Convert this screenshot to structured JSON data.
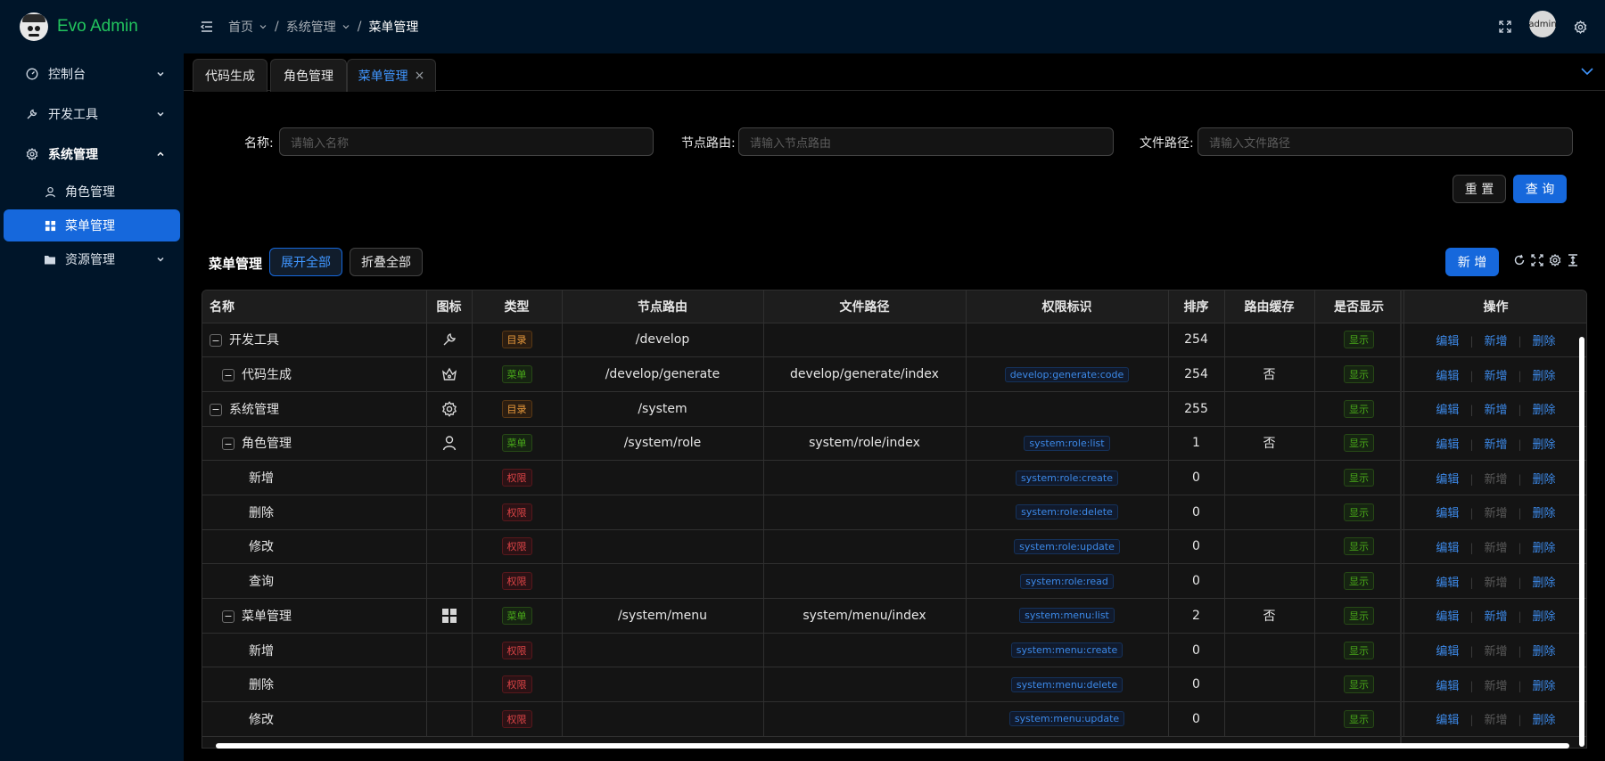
{
  "app": {
    "title": "Evo Admin"
  },
  "sidebar": {
    "items": [
      {
        "label": "控制台",
        "icon": "dashboard-icon"
      },
      {
        "label": "开发工具",
        "icon": "tool-icon"
      },
      {
        "label": "系统管理",
        "icon": "gear-icon",
        "children": [
          {
            "label": "角色管理",
            "icon": "user-icon"
          },
          {
            "label": "菜单管理",
            "icon": "grid-icon",
            "active": true
          }
        ]
      },
      {
        "label": "资源管理",
        "icon": "folder-icon"
      }
    ]
  },
  "header": {
    "breadcrumb": [
      "首页",
      "系统管理",
      "菜单管理"
    ],
    "avatar": "admin"
  },
  "tabs": [
    {
      "label": "代码生成"
    },
    {
      "label": "角色管理"
    },
    {
      "label": "菜单管理",
      "active": true,
      "close": "×"
    }
  ],
  "search": {
    "name_label": "名称:",
    "name_placeholder": "请输入名称",
    "route_label": "节点路由:",
    "route_placeholder": "请输入节点路由",
    "path_label": "文件路径:",
    "path_placeholder": "请输入文件路径",
    "reset": "重 置",
    "query": "查 询"
  },
  "toolbar": {
    "title": "菜单管理",
    "expand_all": "展开全部",
    "collapse_all": "折叠全部",
    "add": "新 增"
  },
  "table": {
    "columns": [
      "名称",
      "图标",
      "类型",
      "节点路由",
      "文件路径",
      "权限标识",
      "排序",
      "路由缓存",
      "是否显示",
      "操作"
    ],
    "ops": {
      "edit": "编辑",
      "add": "新增",
      "delete": "删除"
    },
    "rows": [
      {
        "name": "开发工具",
        "level": 0,
        "expand": "−",
        "icon": "wrench-icon",
        "type": "目录",
        "route": "/develop",
        "path": "",
        "perm": "",
        "sort": "254",
        "cache": "",
        "show": "显示"
      },
      {
        "name": "代码生成",
        "level": 1,
        "expand": "−",
        "icon": "crown-icon",
        "type": "菜单",
        "route": "/develop/generate",
        "path": "develop/generate/index",
        "perm": "develop:generate:code",
        "sort": "254",
        "cache": "否",
        "show": "显示"
      },
      {
        "name": "系统管理",
        "level": 0,
        "expand": "−",
        "icon": "gear-icon",
        "type": "目录",
        "route": "/system",
        "path": "",
        "perm": "",
        "sort": "255",
        "cache": "",
        "show": "显示"
      },
      {
        "name": "角色管理",
        "level": 1,
        "expand": "−",
        "icon": "user-icon",
        "type": "菜单",
        "route": "/system/role",
        "path": "system/role/index",
        "perm": "system:role:list",
        "sort": "1",
        "cache": "否",
        "show": "显示"
      },
      {
        "name": "新增",
        "level": 2,
        "type": "权限",
        "route": "",
        "path": "",
        "perm": "system:role:create",
        "sort": "0",
        "cache": "",
        "show": "显示"
      },
      {
        "name": "删除",
        "level": 2,
        "type": "权限",
        "route": "",
        "path": "",
        "perm": "system:role:delete",
        "sort": "0",
        "cache": "",
        "show": "显示"
      },
      {
        "name": "修改",
        "level": 2,
        "type": "权限",
        "route": "",
        "path": "",
        "perm": "system:role:update",
        "sort": "0",
        "cache": "",
        "show": "显示"
      },
      {
        "name": "查询",
        "level": 2,
        "type": "权限",
        "route": "",
        "path": "",
        "perm": "system:role:read",
        "sort": "0",
        "cache": "",
        "show": "显示"
      },
      {
        "name": "菜单管理",
        "level": 1,
        "expand": "−",
        "icon": "grid-icon",
        "type": "菜单",
        "route": "/system/menu",
        "path": "system/menu/index",
        "perm": "system:menu:list",
        "sort": "2",
        "cache": "否",
        "show": "显示"
      },
      {
        "name": "新增",
        "level": 2,
        "type": "权限",
        "route": "",
        "path": "",
        "perm": "system:menu:create",
        "sort": "0",
        "cache": "",
        "show": "显示"
      },
      {
        "name": "删除",
        "level": 2,
        "type": "权限",
        "route": "",
        "path": "",
        "perm": "system:menu:delete",
        "sort": "0",
        "cache": "",
        "show": "显示"
      },
      {
        "name": "修改",
        "level": 2,
        "type": "权限",
        "route": "",
        "path": "",
        "perm": "system:menu:update",
        "sort": "0",
        "cache": "",
        "show": "显示"
      }
    ]
  }
}
